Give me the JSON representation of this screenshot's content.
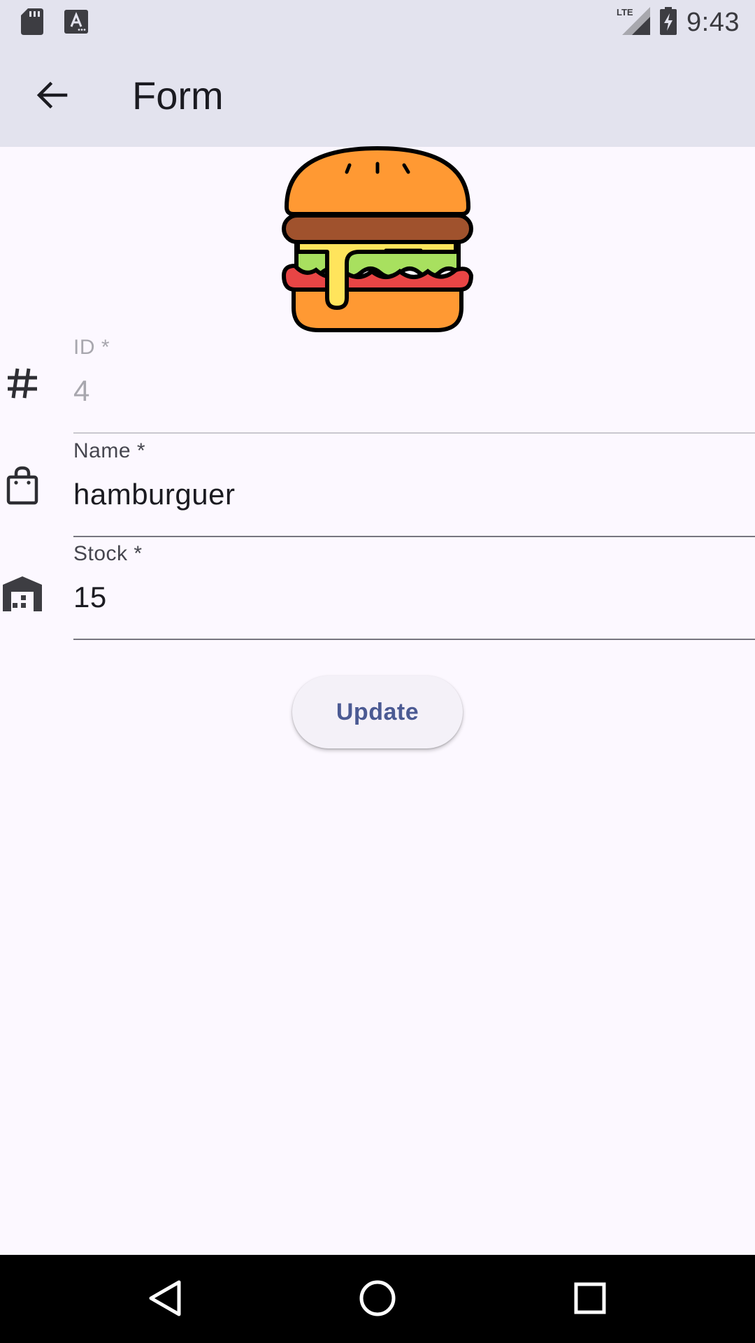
{
  "status_bar": {
    "time": "9:43",
    "network": "LTE",
    "left_icons": [
      "sd-card-icon",
      "text-notification-icon"
    ],
    "right_icons": [
      "lte-signal-icon",
      "battery-charging-icon"
    ]
  },
  "app_bar": {
    "title": "Form",
    "back_icon": "arrow-back-icon"
  },
  "image": {
    "icon": "hamburger-icon"
  },
  "form": {
    "fields": [
      {
        "label": "ID *",
        "value": "4",
        "icon": "hash-icon",
        "disabled": true
      },
      {
        "label": "Name *",
        "value": "hamburguer",
        "icon": "shopping-bag-icon",
        "disabled": false
      },
      {
        "label": "Stock *",
        "value": "15",
        "icon": "warehouse-icon",
        "disabled": false
      }
    ],
    "submit_label": "Update"
  },
  "nav_bar": {
    "buttons": [
      "back-triangle-icon",
      "home-circle-icon",
      "recents-square-icon"
    ]
  },
  "colors": {
    "app_bar_bg": "#e3e3ee",
    "page_bg": "#fcf8ff",
    "button_text": "#4b5a93",
    "button_bg": "#f4f1f8",
    "bun": "#ff9933",
    "patty": "#a0522d",
    "lettuce": "#a8e05f",
    "cheese": "#ffe45c",
    "tomato": "#e84545"
  }
}
